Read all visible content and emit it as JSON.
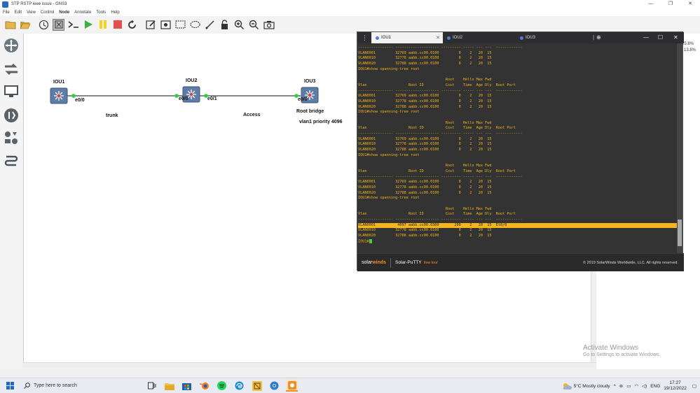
{
  "window": {
    "title": "STP RSTP ieee issue - GNS3",
    "controls": [
      "—",
      "❐",
      "✕"
    ]
  },
  "menu": [
    "File",
    "Edit",
    "View",
    "Control",
    "Node",
    "Annotate",
    "Tools",
    "Help"
  ],
  "topology": {
    "nodes": [
      {
        "id": "IOU1",
        "label": "IOU1"
      },
      {
        "id": "IOU2",
        "label": "IOU2"
      },
      {
        "id": "IOU3",
        "label": "IOU3"
      }
    ],
    "ports": {
      "iou1_e00": "e0/0",
      "iou2_e00": "e0/0",
      "iou2_e01": "e0/1",
      "iou3_e00": "e0/0"
    },
    "labels": {
      "trunk": "trunk",
      "access": "Access",
      "root_bridge": "Root bridge",
      "vlan1_priority": "vlan1 priority 4096"
    }
  },
  "zoom_values": [
    "25.8%",
    "13.8%"
  ],
  "putty": {
    "tabs": [
      {
        "label": "IOU1",
        "active": true
      },
      {
        "label": "IOU2",
        "active": false
      },
      {
        "label": "IOU3",
        "active": false
      }
    ],
    "menu_icon": "⋮",
    "tab_close": "✕",
    "add_icon": "⊕",
    "win_controls": [
      "—",
      "☐",
      "✕"
    ],
    "terminal_lines": [
      "---------------- -------------------- --------- ----- --- ---  ------------",
      "VLAN0001         32769 aabb.cc00.0100         0    2   20  15",
      "VLAN0010         32778 aabb.cc00.0100         0    2   20  15",
      "VLAN0020         32788 aabb.cc00.0100         0    2   20  15",
      "IOU1#show spanning-tree root",
      "",
      "                                        Root    Hello Max Fwd",
      "Vlan                   Root ID          Cost    Time  Age Dly  Root Port",
      "---------------- -------------------- --------- ----- --- ---  ------------",
      "VLAN0001         32769 aabb.cc00.0100         0    2   20  15",
      "VLAN0010         32778 aabb.cc00.0100         0    2   20  15",
      "VLAN0020         32788 aabb.cc00.0100         0    2   20  15",
      "IOU1#show spanning-tree root",
      "",
      "                                        Root    Hello Max Fwd",
      "Vlan                   Root ID          Cost    Time  Age Dly  Root Port",
      "---------------- -------------------- --------- ----- --- ---  ------------",
      "VLAN0001         32769 aabb.cc00.0100         0    2   20  15",
      "VLAN0010         32778 aabb.cc00.0100         0    2   20  15",
      "VLAN0020         32788 aabb.cc00.0100         0    2   20  15",
      "IOU1#show spanning-tree root",
      "",
      "                                        Root    Hello Max Fwd",
      "Vlan                   Root ID          Cost    Time  Age Dly  Root Port",
      "---------------- -------------------- --------- ----- --- ---  ------------",
      "VLAN0001         32769 aabb.cc00.0100         0    2   20  15",
      "VLAN0010         32778 aabb.cc00.0100         0    2   20  15",
      "VLAN0020         32788 aabb.cc00.0100         0    2   20  15",
      "IOU1#show spanning-tree root",
      "",
      "                                        Root    Hello Max Fwd",
      "Vlan                   Root ID          Cost    Time  Age Dly  Root Port",
      "---------------- -------------------- --------- ----- --- ---  ------------",
      "VLAN0001          4097 aabb.cc00.0300       200    2   20  15  Et0/0",
      "VLAN0010         32778 aabb.cc00.0100         0    2   20  15",
      "VLAN0020         32788 aabb.cc00.0100         0    2   20  15",
      "IOU1#"
    ],
    "highlighted_line": 33,
    "footer": {
      "brand_a": "solar",
      "brand_b": "winds",
      "product": "Solar-PuTTY",
      "product_tag": "free tool",
      "copyright": "© 2019 SolarWinds Worldwide, LLC. All rights reserved."
    }
  },
  "watermark": {
    "heading": "Activate Windows",
    "sub": "Go to Settings to activate Windows."
  },
  "taskbar": {
    "search_placeholder": "Type here to search",
    "weather": "5°C  Mostly cloudy",
    "lang": "ENG",
    "time": "17:27",
    "date": "19/12/2022"
  },
  "colors": {
    "terminal_text": "#f2b21b",
    "terminal_bg": "#333333",
    "highlight": "#f5b51c",
    "link_dot": "#2ecc40"
  }
}
